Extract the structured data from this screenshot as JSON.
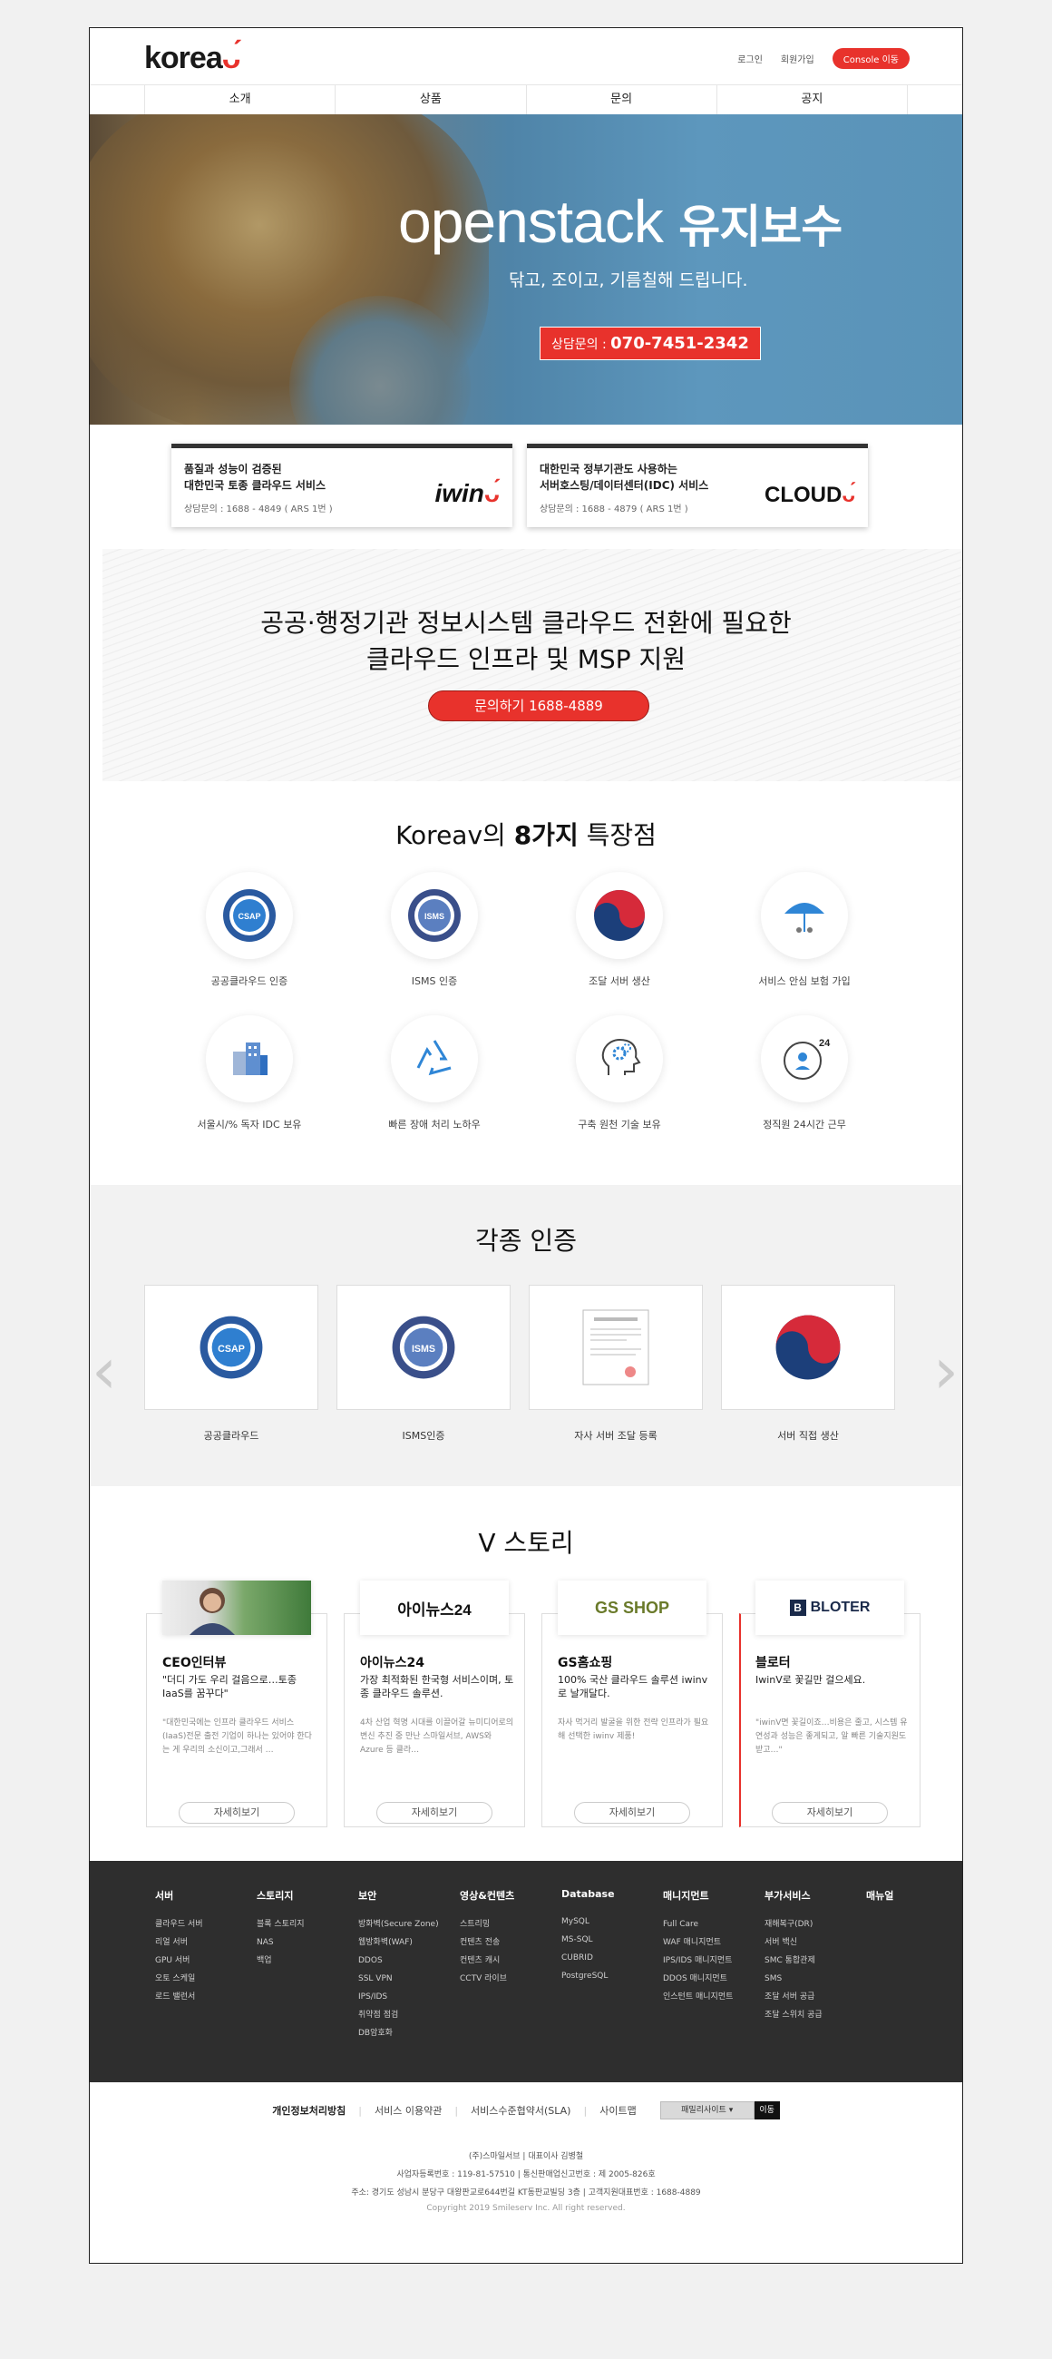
{
  "header": {
    "logo_text": "korea",
    "links": [
      "로그인",
      "회원가입"
    ],
    "console_label": "Console 이동"
  },
  "nav": [
    "소개",
    "상품",
    "문의",
    "공지"
  ],
  "hero": {
    "title_en": "openstack",
    "title_ko": "유지보수",
    "subtitle": "닦고, 조이고, 기름칠해 드립니다.",
    "call_label": "상담문의 : ",
    "call_number": "070-7451-2342"
  },
  "services": [
    {
      "line1": "품질과 성능이 검증된",
      "line2": "대한민국 토종 클라우드 서비스",
      "phone": "상담문의 : 1688 - 4849 ( ARS 1번 )",
      "logo": "iwin"
    },
    {
      "line1": "대한민국 정부기관도 사용하는",
      "line2": "서버호스팅/데이터센터(IDC) 서비스",
      "phone": "상담문의 : 1688 - 4879 ( ARS 1번 )",
      "logo": "CLOUD"
    }
  ],
  "cloud_banner": {
    "line1": "공공·행정기관 정보시스템 클라우드 전환에 필요한",
    "line2": "클라우드 인프라 및 MSP 지원",
    "button": "문의하기 1688-4889"
  },
  "features": {
    "title_pre": "Koreav의 ",
    "title_bold": "8가지",
    "title_post": " 특장점",
    "items": [
      {
        "label": "공공클라우드 인증",
        "icon": "csap-badge-icon"
      },
      {
        "label": "ISMS 인증",
        "icon": "isms-badge-icon"
      },
      {
        "label": "조달 서버 생산",
        "icon": "taegeuk-icon"
      },
      {
        "label": "서비스 안심 보험 가입",
        "icon": "umbrella-icon"
      },
      {
        "label": "서울시/% 독자 IDC 보유",
        "icon": "building-icon"
      },
      {
        "label": "빠른 장애 처리 노하우",
        "icon": "recycle-icon"
      },
      {
        "label": "구축 원천 기술 보유",
        "icon": "head-gear-icon"
      },
      {
        "label": "정직원 24시간 근무",
        "icon": "clock-24-icon"
      }
    ]
  },
  "certs": {
    "title": "각종 인증",
    "items": [
      {
        "label": "공공클라우드",
        "icon": "csap-badge-icon"
      },
      {
        "label": "ISMS인증",
        "icon": "isms-badge-icon"
      },
      {
        "label": "자사 서버 조달 등록",
        "icon": "certificate-doc-icon"
      },
      {
        "label": "서버 직접 생산",
        "icon": "taegeuk-icon"
      }
    ]
  },
  "stories": {
    "title": "V 스토리",
    "items": [
      {
        "name": "CEO인터뷰",
        "quote": "\"더디 가도 우리 걸음으로…토종 IaaS를 꿈꾸다\"",
        "desc": "\"대한민국에는 인프라 클라우드 서비스(IaaS)전문 출전 기업이 하나는 있어야 한다는 게 우리의 소신이고,그래서 …",
        "brand": "",
        "more": "자세히보기"
      },
      {
        "name": "아이뉴스24",
        "quote": "가장 최적화된 한국형 서비스이며, 토종 클라우드 솔루션.",
        "desc": "4차 산업 혁명 시대를 이끌어갈 뉴미디어로의 변신 추진 중 만난 스마일서브, AWS와 Azure 등 클라…",
        "brand": "아이뉴스24",
        "more": "자세히보기"
      },
      {
        "name": "GS홈쇼핑",
        "quote": "100% 국산 클라우드 솔루션 iwinv로 날개달다.",
        "desc": "자사 먹거리 발굴을 위한 전략 인프라가 필요해 선택한 iwinv 제품!",
        "brand": "GS SHOP",
        "more": "자세히보기"
      },
      {
        "name": "블로터",
        "quote": "IwinV로 꽃길만 걸으세요.",
        "desc": "\"iwinV면 꽃길이죠…비용은 줄고, 시스템 유연성과 성능은 좋게되고, 알 빠른 기술지원도 받고…\"",
        "brand": "BLOTER",
        "more": "자세히보기"
      }
    ]
  },
  "footer": {
    "columns": [
      {
        "title": "서버",
        "items": [
          "클라우드 서버",
          "리얼 서버",
          "GPU 서버",
          "오토 스케일",
          "로드 밸런서"
        ]
      },
      {
        "title": "스토리지",
        "items": [
          "블록 스토리지",
          "NAS",
          "백업"
        ]
      },
      {
        "title": "보안",
        "items": [
          "방화벽(Secure Zone)",
          "웹방화벽(WAF)",
          "DDOS",
          "SSL VPN",
          "IPS/IDS",
          "취약점 점검",
          "DB암호화"
        ]
      },
      {
        "title": "영상&컨텐츠",
        "items": [
          "스트리밍",
          "컨텐츠 전송",
          "컨텐츠 캐시",
          "CCTV 라이브"
        ]
      },
      {
        "title": "Database",
        "items": [
          "MySQL",
          "MS-SQL",
          "CUBRID",
          "PostgreSQL"
        ]
      },
      {
        "title": "매니지먼트",
        "items": [
          "Full Care",
          "WAF 매니지먼트",
          "IPS/IDS 매니지먼트",
          "DDOS 매니지먼트",
          "인스턴트 매니지먼트"
        ]
      },
      {
        "title": "부가서비스",
        "items": [
          "재해복구(DR)",
          "서버 백신",
          "SMC 통합관제",
          "SMS",
          "조달 서버 공급",
          "조달 스위치 공급"
        ]
      },
      {
        "title": "매뉴얼",
        "items": []
      }
    ],
    "links": [
      "개인정보처리방침",
      "서비스 이용약관",
      "서비스수준협약서(SLA)",
      "사이트맵"
    ],
    "family_site": "패밀리사이트 ▾",
    "family_go": "이동",
    "info": [
      "(주)스마일서브 | 대표이사 김병철",
      "사업자등록번호 : 119-81-57510 | 통신판매업신고번호 : 제 2005-826호",
      "주소: 경기도 성남시 분당구 대왕판교로644번길 KT동판교빌딩 3층 | 고객지원대표번호 : 1688-4889",
      "Copyright 2019 Smileserv Inc. All right reserved."
    ]
  }
}
